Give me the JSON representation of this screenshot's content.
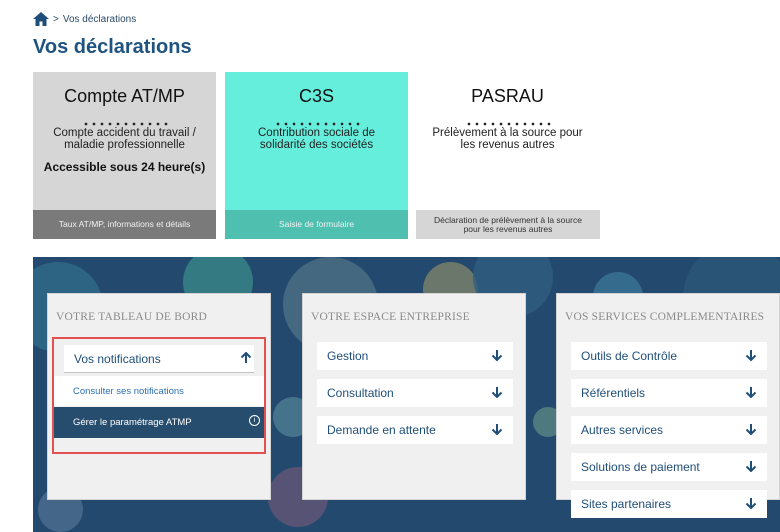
{
  "breadcrumb": {
    "separator": ">",
    "current": "Vos déclarations"
  },
  "page_title": "Vos déclarations",
  "tiles": [
    {
      "name": "Compte AT/MP",
      "description_line1": "Compte accident du travail /",
      "description_line2": "maladie professionnelle",
      "extra": "Accessible sous 24 heure(s)",
      "footer": "Taux AT/MP, informations et détails"
    },
    {
      "name": "C3S",
      "description_line1": "Contribution sociale de",
      "description_line2": "solidarité des sociétés",
      "footer": "Saisie de formulaire"
    },
    {
      "name": "PASRAU",
      "description_line1": "Prélèvement à la source pour",
      "description_line2": "les revenus autres",
      "footer_line1": "Déclaration de prélèvement à la source",
      "footer_line2": "pour les revenus autres"
    }
  ],
  "panels": {
    "tableau": {
      "title": "VOTRE TABLEAU DE BORD",
      "notifications_label": "Vos notifications",
      "items": [
        "Consulter ses notifications",
        "Gérer le paramétrage ATMP"
      ]
    },
    "entreprise": {
      "title": "VOTRE ESPACE ENTREPRISE",
      "items": [
        "Gestion",
        "Consultation",
        "Demande en attente"
      ]
    },
    "services": {
      "title": "VOS SERVICES COMPLEMENTAIRES",
      "items": [
        "Outils de Contrôle",
        "Référentiels",
        "Autres services",
        "Solutions de paiement",
        "Sites partenaires"
      ]
    }
  },
  "icons": {
    "home": "home-icon",
    "arrow_down": "arrow-down-icon",
    "arrow_up": "arrow-up-icon",
    "info": "info-icon"
  },
  "colors": {
    "title": "#1f5380",
    "tile_grey": "#d6d6d6",
    "tile_teal": "#66eedd",
    "dashboard_bg": "#234a6e",
    "highlight": "#e25050"
  }
}
